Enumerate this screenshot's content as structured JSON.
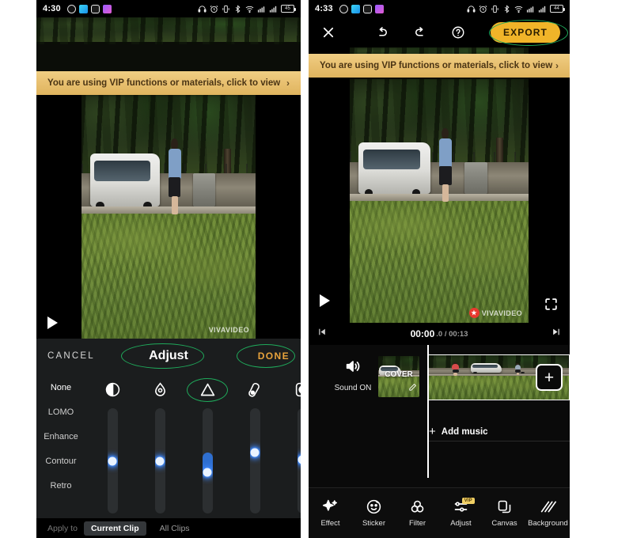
{
  "left_phone": {
    "status_bar": {
      "time": "4:30",
      "battery_text": "45",
      "left_icons": [
        "messenger-icon",
        "telegram-icon",
        "instagram-icon",
        "gallery-icon"
      ],
      "right_icons": [
        "headphones-icon",
        "alarm-icon",
        "vibrate-icon",
        "bluetooth-icon",
        "wifi-icon",
        "network-icon",
        "signal-icon",
        "battery-icon"
      ]
    },
    "vip_banner": {
      "text": "You are using VIP functions or materials, click to view",
      "chevron": "›",
      "bg_color": "#e8c070",
      "text_color": "#4a3414"
    },
    "preview": {
      "watermark": "VIVAVIDEO",
      "play_icon": "play-icon"
    },
    "adjust_panel": {
      "cancel_label": "CANCEL",
      "title": "Adjust",
      "done_label": "DONE",
      "done_color": "#e8a33c",
      "annotation_color": "#1faa5b",
      "presets": [
        {
          "label": "None",
          "active": true
        },
        {
          "label": "LOMO",
          "active": false
        },
        {
          "label": "Enhance",
          "active": false
        },
        {
          "label": "Contour",
          "active": false
        },
        {
          "label": "Retro",
          "active": false
        }
      ],
      "sliders": [
        {
          "icon": "contrast-icon",
          "value": 50,
          "highlighted": false
        },
        {
          "icon": "saturation-droplet-icon",
          "value": 50,
          "highlighted": false
        },
        {
          "icon": "sharpen-triangle-icon",
          "value": 42,
          "highlighted": true
        },
        {
          "icon": "temperature-icon",
          "value": 58,
          "highlighted": false
        },
        {
          "icon": "vignette-icon",
          "value": 48,
          "highlighted": false
        }
      ],
      "footer": {
        "apply_label": "Apply to",
        "options": [
          {
            "label": "Current Clip",
            "selected": true
          },
          {
            "label": "All Clips",
            "selected": false
          }
        ]
      }
    }
  },
  "right_phone": {
    "status_bar": {
      "time": "4:33",
      "battery_text": "44",
      "left_icons": [
        "messenger-icon",
        "telegram-icon",
        "instagram-icon",
        "gallery-icon"
      ],
      "right_icons": [
        "headphones-icon",
        "alarm-icon",
        "vibrate-icon",
        "bluetooth-icon",
        "wifi-icon",
        "network-icon",
        "signal-icon",
        "battery-icon"
      ]
    },
    "topbar": {
      "close_icon": "close-icon",
      "undo_icon": "undo-icon",
      "redo_icon": "redo-icon",
      "help_icon": "help-icon",
      "export_label": "EXPORT",
      "export_bg": "#f0b429",
      "annotation_color": "#1faa5b"
    },
    "vip_banner": {
      "text": "You are using VIP functions or materials, click to view",
      "chevron": "›",
      "bg_color": "#e8c070",
      "text_color": "#4a3414"
    },
    "preview": {
      "watermark": "VIVAVIDEO",
      "play_icon": "play-icon",
      "fullscreen_icon": "fullscreen-icon"
    },
    "timebar": {
      "current_time": "00:00",
      "frames_and_total": ".0 / 00:13",
      "prev_icon": "skip-previous-icon",
      "next_icon": "skip-next-icon"
    },
    "timeline": {
      "sound_icon": "speaker-on-icon",
      "sound_label": "Sound ON",
      "cover_label": "COVER",
      "cover_edit_icon": "pencil-icon",
      "add_clip_label": "+",
      "add_music_label": "Add music",
      "add_music_plus": "+"
    },
    "bottom_nav": [
      {
        "label": "Effect",
        "icon": "sparkle-icon",
        "vip": false
      },
      {
        "label": "Sticker",
        "icon": "smiley-sticker-icon",
        "vip": false
      },
      {
        "label": "Filter",
        "icon": "filter-circles-icon",
        "vip": false
      },
      {
        "label": "Adjust",
        "icon": "sliders-icon",
        "vip": true,
        "vip_label": "VIP"
      },
      {
        "label": "Canvas",
        "icon": "canvas-icon",
        "vip": false
      },
      {
        "label": "Background",
        "icon": "background-lines-icon",
        "vip": false
      }
    ]
  }
}
